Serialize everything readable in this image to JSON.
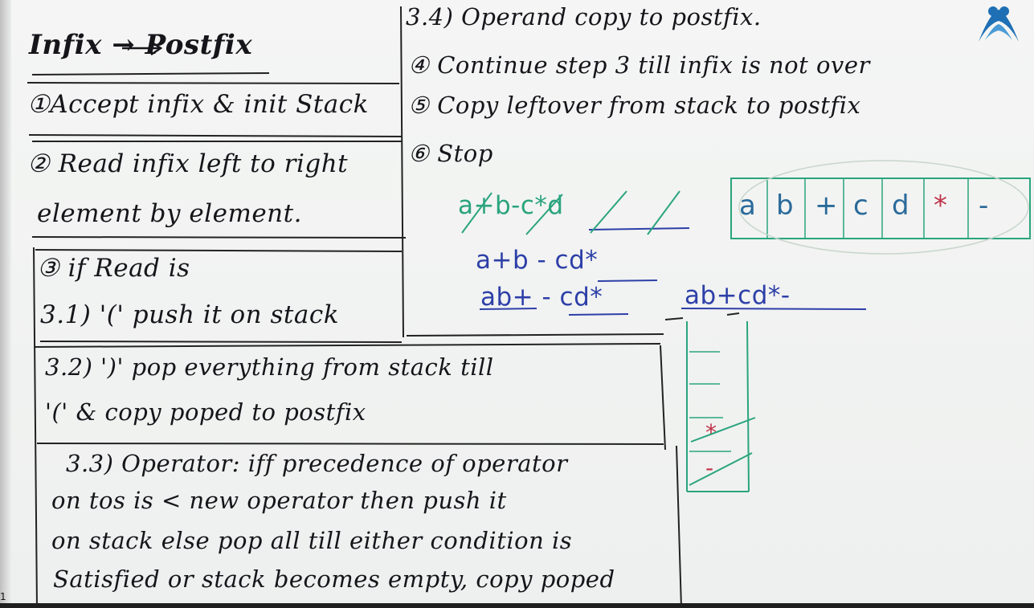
{
  "board": {
    "title": "Infix → Postfix",
    "steps": {
      "s1": "①Accept infix & init Stack",
      "s2_line1": "② Read infix left to right",
      "s2_line2": "element by element.",
      "s3": "③ if Read is",
      "s31": "3.1) '(' push it on stack",
      "s32_line1": "3.2) ')' pop everything from stack till",
      "s32_line2": "'(' & copy poped to postfix",
      "s33_line1": "3.3) Operator: iff precedence of operator",
      "s33_line2": "on tos is < new operator then push it",
      "s33_line3": "on stack else pop all till either condition is",
      "s33_line4": "Satisfied or stack becomes empty, copy poped",
      "s34": "3.4) Operand copy to postfix.",
      "s4": "④ Continue step 3 till infix is not over",
      "s5": "⑤ Copy leftover from stack to postfix",
      "s6": "⑥ Stop"
    },
    "example": {
      "infix": "a+b-c*d",
      "step1": "a+b - cd*",
      "step2": "ab+ - cd*",
      "result": "ab+cd*-",
      "postfix_cells": [
        "a",
        "b",
        "+",
        "c",
        "d",
        "*",
        "-"
      ],
      "stack_items": [
        "*",
        "-"
      ]
    }
  },
  "colors": {
    "board": "#f1f2f1",
    "ink_black": "#15151a",
    "ink_blue": "#2d3fa8",
    "ink_green": "#2aa47e",
    "ink_red": "#c0344a"
  },
  "logo": {
    "icon": "brand-logo-icon"
  }
}
